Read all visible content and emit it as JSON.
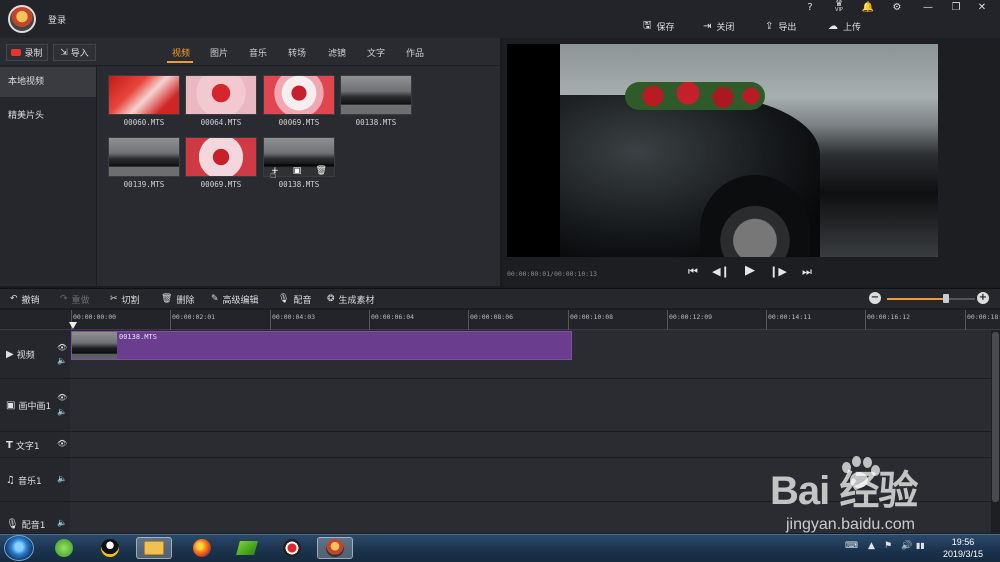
{
  "header": {
    "login_label": "登录",
    "sys_icons": [
      "help-icon",
      "vip-icon",
      "bell-icon",
      "settings-icon",
      "minimize-icon",
      "restore-icon",
      "close-window-icon"
    ],
    "help_glyph": "?",
    "vip_label": "VIP",
    "actions": [
      {
        "id": "save",
        "label": "保存",
        "icon": "save-icon"
      },
      {
        "id": "close",
        "label": "关闭",
        "icon": "exit-icon"
      },
      {
        "id": "export",
        "label": "导出",
        "icon": "export-icon"
      },
      {
        "id": "upload",
        "label": "上传",
        "icon": "cloud-upload-icon"
      }
    ]
  },
  "library": {
    "record_label": "录制",
    "import_label": "导入",
    "tabs": [
      "视频",
      "图片",
      "音乐",
      "转场",
      "滤镜",
      "文字",
      "作品"
    ],
    "active_tab": "视频",
    "nav": [
      "本地视频",
      "精美片头"
    ],
    "active_nav": "本地视频",
    "media": [
      {
        "name": "00060.MTS",
        "style": "red"
      },
      {
        "name": "00064.MTS",
        "style": "pink"
      },
      {
        "name": "00069.MTS",
        "style": "wall"
      },
      {
        "name": "00138.MTS",
        "style": "car"
      },
      {
        "name": "00139.MTS",
        "style": "car"
      },
      {
        "name": "00069.MTS",
        "style": "wall2"
      },
      {
        "name": "00138.MTS",
        "style": "car"
      }
    ],
    "hover_actions": [
      "add-icon",
      "pip-icon",
      "trash-icon"
    ]
  },
  "preview": {
    "timecode": "00:00:00:01/00:00:10:13",
    "controls": [
      "skip-start-icon",
      "step-back-icon",
      "play-icon",
      "step-forward-icon",
      "skip-end-icon"
    ]
  },
  "edit_tools": [
    {
      "label": "撤销",
      "icon": "undo-icon",
      "enabled": true
    },
    {
      "label": "重做",
      "icon": "redo-icon",
      "enabled": false
    },
    {
      "label": "切割",
      "icon": "scissors-icon",
      "enabled": true
    },
    {
      "label": "删除",
      "icon": "trash-icon",
      "enabled": true
    },
    {
      "label": "高级编辑",
      "icon": "pencil-icon",
      "enabled": true
    },
    {
      "label": "配音",
      "icon": "microphone-icon",
      "enabled": true
    },
    {
      "label": "生成素材",
      "icon": "film-reel-icon",
      "enabled": true
    }
  ],
  "zoom": {
    "level": 0.67
  },
  "ruler": {
    "ticks": [
      "00:00:00:00",
      "00:00:02:01",
      "00:00:04:03",
      "00:00:06:04",
      "00:00:08:06",
      "00:00:10:08",
      "00:00:12:09",
      "00:00:14:11",
      "00:00:16:12",
      "00:00:18:"
    ]
  },
  "tracks": [
    {
      "name": "视频",
      "icon": "play-square-icon",
      "eye": true,
      "mute": true
    },
    {
      "name": "画中画1",
      "icon": "pip-icon",
      "eye": true,
      "mute": true
    },
    {
      "name": "文字1",
      "icon": "text-icon",
      "eye": true,
      "mute": false
    },
    {
      "name": "音乐1",
      "icon": "music-note-icon",
      "eye": false,
      "mute": true
    },
    {
      "name": "配音1",
      "icon": "microphone-icon",
      "eye": false,
      "mute": true
    }
  ],
  "clip": {
    "name": "00138.MTS"
  },
  "taskbar": {
    "apps": [
      "360-browser-icon",
      "qq-icon",
      "file-explorer-icon",
      "firefox-icon",
      "video-app-icon",
      "record-app-icon",
      "editor-app-icon"
    ],
    "time": "19:56",
    "date": "2019/3/15"
  },
  "watermark": {
    "logo": "Bai 经验",
    "url": "jingyan.baidu.com"
  }
}
